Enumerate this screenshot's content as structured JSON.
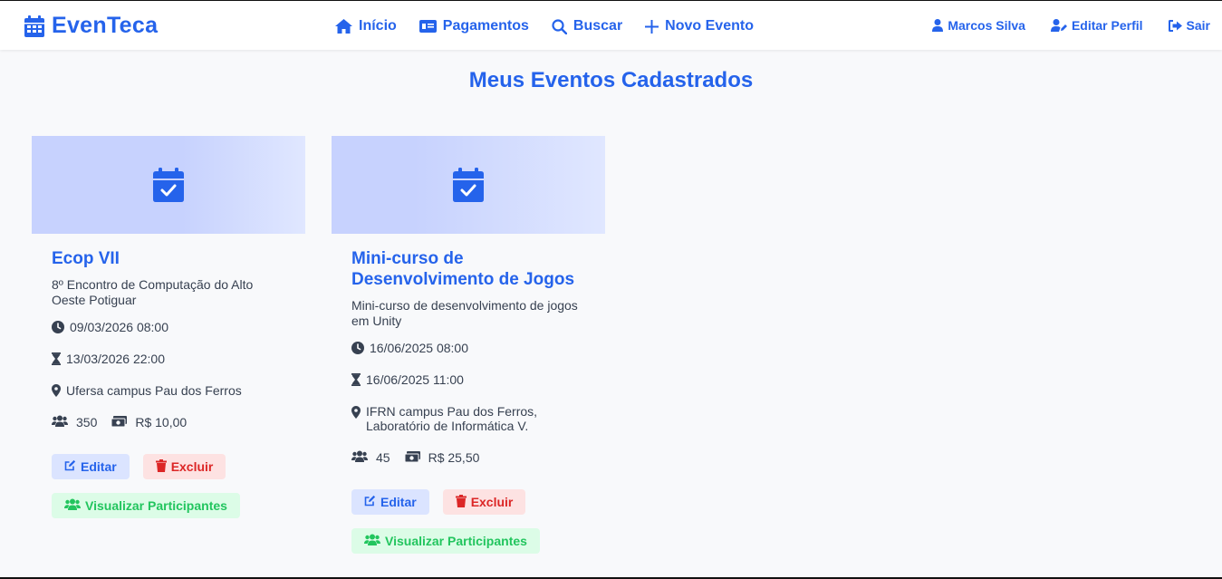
{
  "app": {
    "brand": "EvenTeca"
  },
  "nav": {
    "home": "Início",
    "payments": "Pagamentos",
    "search": "Buscar",
    "new_event": "Novo Evento",
    "user": "Marcos Silva",
    "edit_profile": "Editar Perfil",
    "logout": "Sair"
  },
  "page": {
    "title": "Meus Eventos Cadastrados"
  },
  "events": [
    {
      "title": "Ecop VII",
      "description": "8º Encontro de Computação do Alto Oeste Potiguar",
      "start": "09/03/2026 08:00",
      "end": "13/03/2026 22:00",
      "location": "Ufersa campus Pau dos Ferros",
      "capacity": "350",
      "price": "R$ 10,00",
      "edit_label": "Editar",
      "delete_label": "Excluir",
      "participants_label": "Visualizar Participantes"
    },
    {
      "title": "Mini-curso de Desenvolvimento de Jogos",
      "description": "Mini-curso de desenvolvimento de jogos em Unity",
      "start": "16/06/2025 08:00",
      "end": "16/06/2025 11:00",
      "location": "IFRN campus Pau dos Ferros, Laboratório de Informática V.",
      "capacity": "45",
      "price": "R$ 25,50",
      "edit_label": "Editar",
      "delete_label": "Excluir",
      "participants_label": "Visualizar Participantes"
    }
  ],
  "colors": {
    "primary": "#2563eb",
    "banner": "#c7d2fe",
    "edit_bg": "#dbe4ff",
    "delete_bg": "#fde2e2",
    "delete_text": "#dc2626",
    "participants_bg": "#dcfce7",
    "participants_text": "#22c55e",
    "page_bg": "#f8f9fb"
  },
  "icons": {
    "brand": "calendar-icon",
    "home": "house-icon",
    "payments": "money-card-icon",
    "search": "magnifier-icon",
    "new_event": "plus-icon",
    "user": "user-icon",
    "edit_profile": "user-pen-icon",
    "logout": "sign-out-icon",
    "banner": "calendar-check-icon",
    "start": "clock-icon",
    "end": "hourglass-icon",
    "location": "map-pin-icon",
    "capacity": "users-icon",
    "price": "money-bill-icon",
    "edit": "edit-icon",
    "delete": "trash-icon",
    "participants": "users-icon"
  }
}
